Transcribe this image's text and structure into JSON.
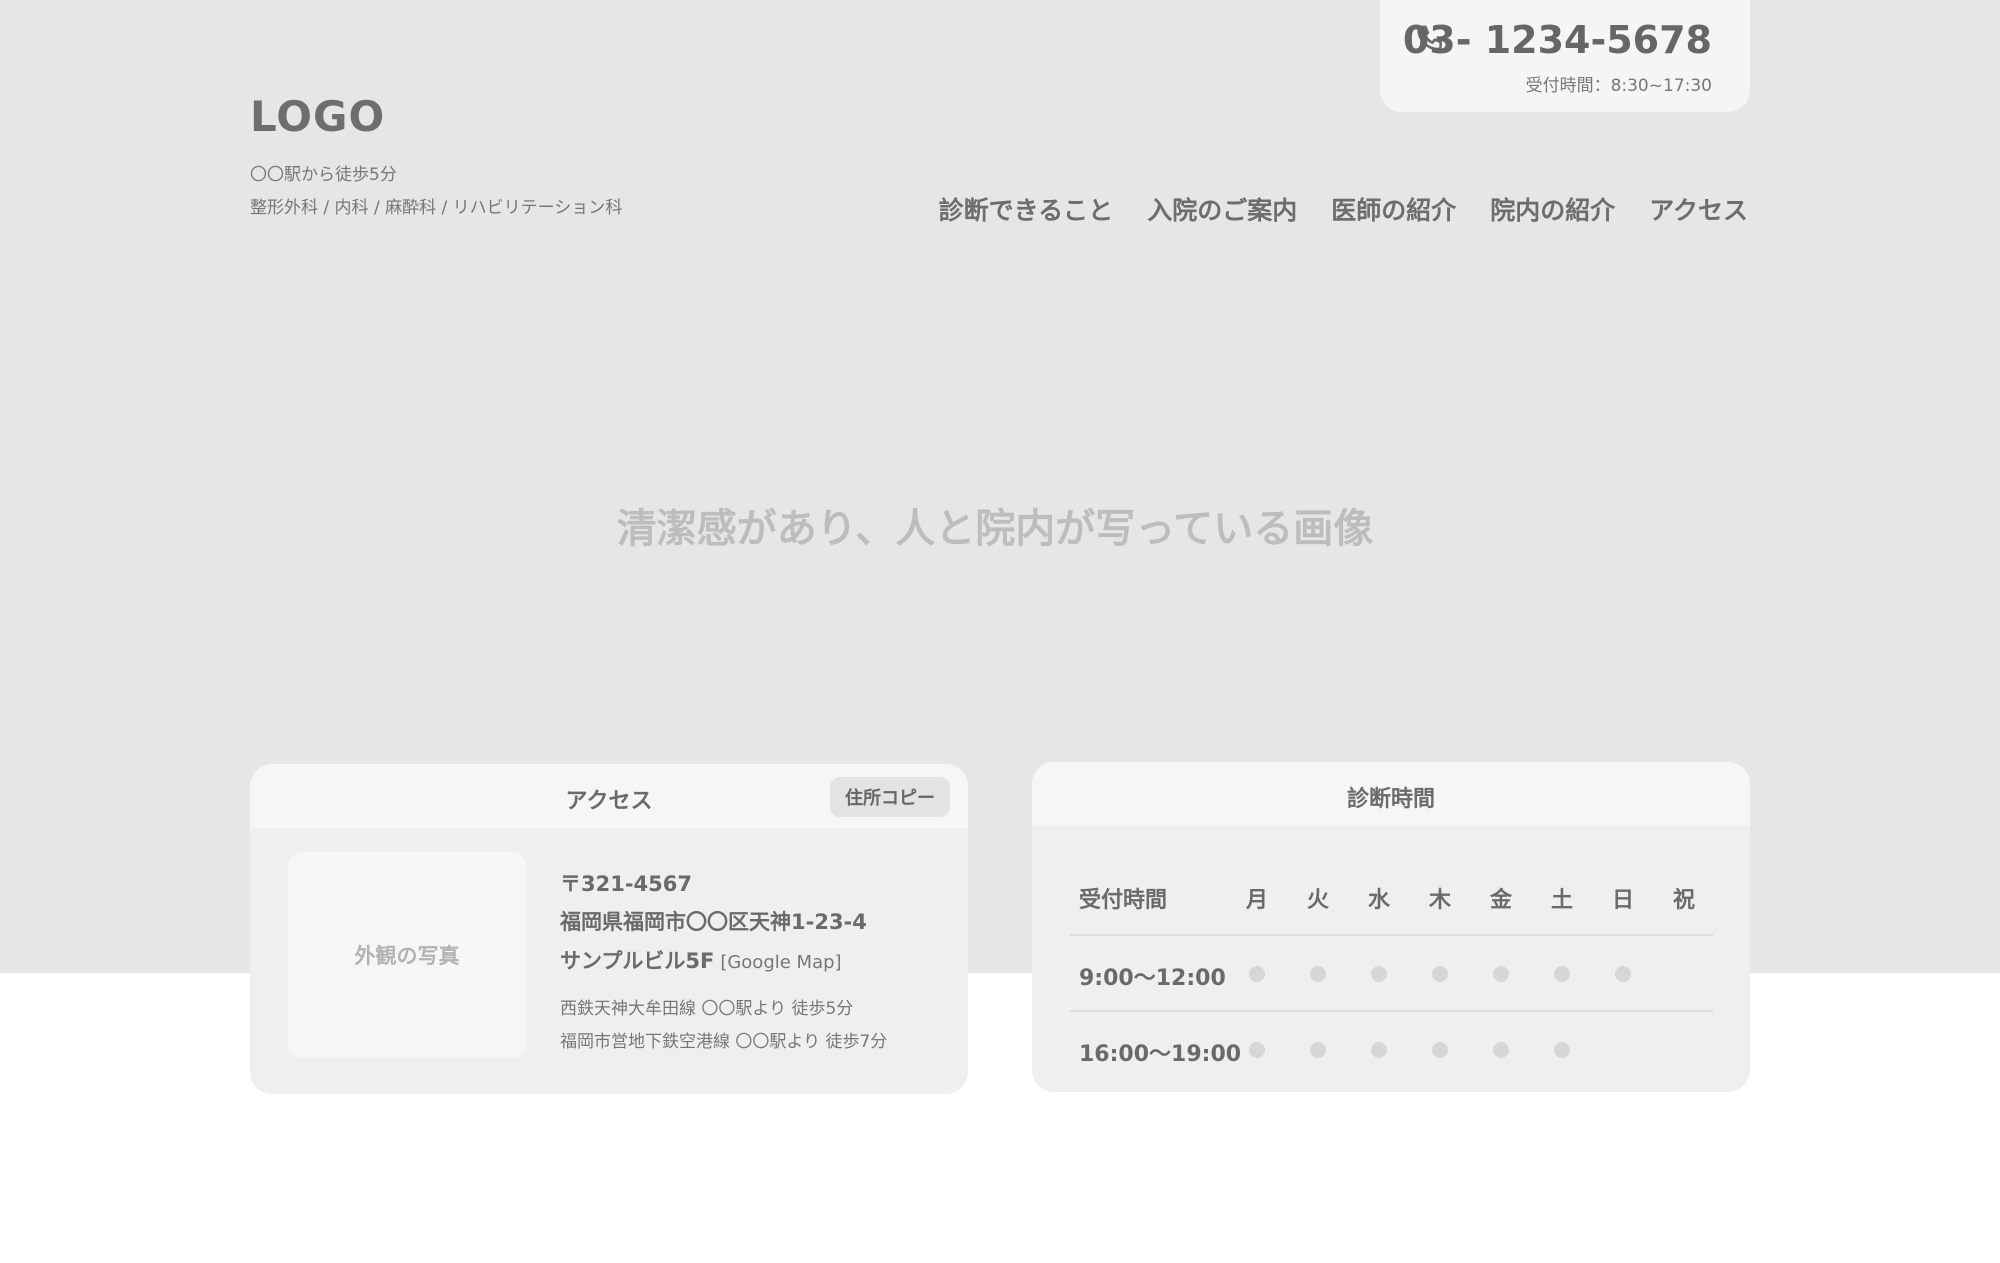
{
  "header": {
    "logo": "LOGO",
    "tagline_line1": "〇〇駅から徒歩5分",
    "tagline_line2": "整形外科 / 内科 / 麻酔科 / リハビリテーション科",
    "phone_number": "03- 1234-5678",
    "phone_hours": "受付時間：8:30~17:30",
    "phone_icon": "phone-icon"
  },
  "nav": {
    "items": [
      "診断できること",
      "入院のご案内",
      "医師の紹介",
      "院内の紹介",
      "アクセス"
    ]
  },
  "hero": {
    "caption": "清潔感があり、人と院内が写っている画像"
  },
  "access": {
    "title": "アクセス",
    "copy_button": "住所コピー",
    "photo_placeholder": "外観の写真",
    "zip": "〒321-4567",
    "address_line1": "福岡県福岡市〇〇区天神1-23-4",
    "address_line2": "サンプルビル5F",
    "map_link": "[Google Map]",
    "route1": "西鉄天神大牟田線 〇〇駅より 徒歩5分",
    "route2": "福岡市営地下鉄空港線 〇〇駅より 徒歩7分"
  },
  "hours": {
    "title": "診断時間",
    "header_label": "受付時間",
    "days": [
      "月",
      "火",
      "水",
      "木",
      "金",
      "土",
      "日",
      "祝"
    ],
    "rows": [
      {
        "label": "9:00〜12:00",
        "open": [
          true,
          true,
          true,
          true,
          true,
          true,
          true,
          false
        ]
      },
      {
        "label": "16:00〜19:00",
        "open": [
          true,
          true,
          true,
          true,
          true,
          true,
          false,
          false
        ]
      }
    ]
  },
  "colors": {
    "hero_bg": "#e6e6e6",
    "card_bg": "#efefef",
    "card_header_bg": "#f6f6f6",
    "dot": "#d6d6d6"
  }
}
